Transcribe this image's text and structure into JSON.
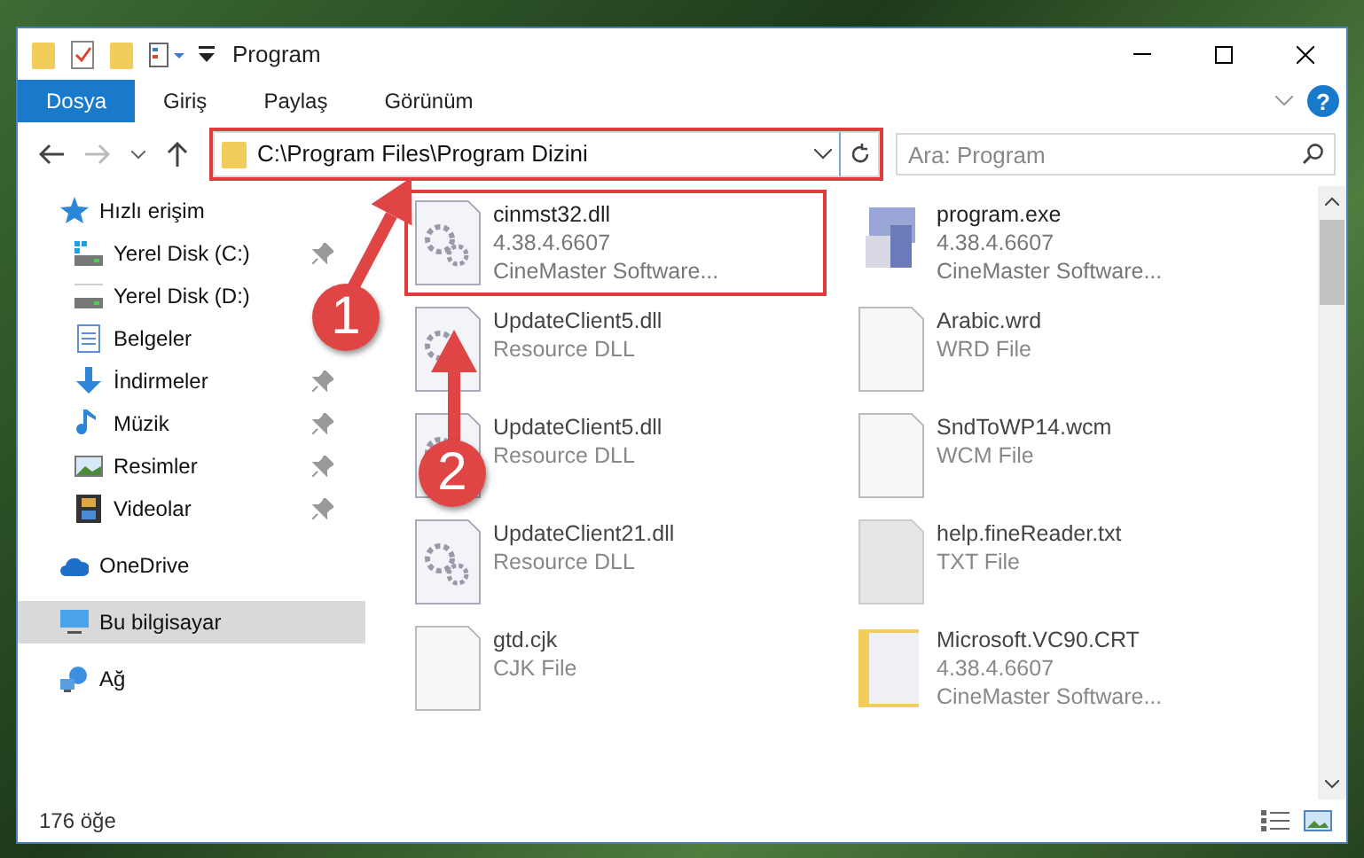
{
  "window": {
    "title": "Program"
  },
  "ribbon": {
    "tabs": [
      {
        "label": "Dosya",
        "selected": true
      },
      {
        "label": "Giriş",
        "selected": false
      },
      {
        "label": "Paylaş",
        "selected": false
      },
      {
        "label": "Görünüm",
        "selected": false
      }
    ]
  },
  "help_button": {
    "label": "?"
  },
  "address_bar": {
    "path": "C:\\Program Files\\Program Dizini",
    "highlighted": true
  },
  "search": {
    "placeholder": "Ara: Program"
  },
  "sidebar": {
    "items": [
      {
        "label": "Hızlı erişim",
        "kind": "star",
        "selected": false,
        "children": [
          {
            "label": "Yerel Disk (C:)",
            "kind": "system-drive",
            "pinned": true,
            "selected": false
          },
          {
            "label": "Yerel Disk (D:)",
            "kind": "drive",
            "pinned": false,
            "selected": false
          },
          {
            "label": "Belgeler",
            "kind": "document",
            "pinned": false,
            "selected": false
          },
          {
            "label": "İndirmeler",
            "kind": "download",
            "pinned": true,
            "selected": false
          },
          {
            "label": "Müzik",
            "kind": "music",
            "pinned": true,
            "selected": false
          },
          {
            "label": "Resimler",
            "kind": "picture",
            "pinned": true,
            "selected": false
          },
          {
            "label": "Videolar",
            "kind": "video",
            "pinned": true,
            "selected": false
          }
        ]
      },
      {
        "label": "OneDrive",
        "kind": "cloud",
        "selected": false
      },
      {
        "label": "Bu bilgisayar",
        "kind": "computer",
        "selected": true
      },
      {
        "label": "Ağ",
        "kind": "network",
        "selected": false
      }
    ]
  },
  "files": [
    {
      "name": "cinmst32.dll",
      "lines": [
        "4.38.4.6607",
        "CineMaster Software..."
      ],
      "kind": "dll",
      "highlighted": true
    },
    {
      "name": "program.exe",
      "lines": [
        "4.38.4.6607",
        "CineMaster Software..."
      ],
      "kind": "exe",
      "highlighted": false
    },
    {
      "name": "UpdateClient5.dll",
      "lines": [
        "Resource DLL"
      ],
      "kind": "dll",
      "highlighted": false
    },
    {
      "name": "Arabic.wrd",
      "lines": [
        "WRD File"
      ],
      "kind": "file",
      "highlighted": false
    },
    {
      "name": "UpdateClient5.dll",
      "lines": [
        "Resource DLL"
      ],
      "kind": "dll",
      "highlighted": false
    },
    {
      "name": "SndToWP14.wcm",
      "lines": [
        "WCM File"
      ],
      "kind": "file",
      "highlighted": false
    },
    {
      "name": "UpdateClient21.dll",
      "lines": [
        "Resource DLL"
      ],
      "kind": "dll",
      "highlighted": false
    },
    {
      "name": "help.fineReader.txt",
      "lines": [
        "TXT File"
      ],
      "kind": "text",
      "highlighted": false
    },
    {
      "name": "gtd.cjk",
      "lines": [
        "CJK File"
      ],
      "kind": "file",
      "highlighted": false
    },
    {
      "name": "Microsoft.VC90.CRT",
      "lines": [
        "4.38.4.6607",
        "CineMaster Software..."
      ],
      "kind": "folder",
      "highlighted": false
    }
  ],
  "status_bar": {
    "item_count": "176 öğe"
  },
  "annotations": [
    {
      "label": "1"
    },
    {
      "label": "2"
    }
  ]
}
